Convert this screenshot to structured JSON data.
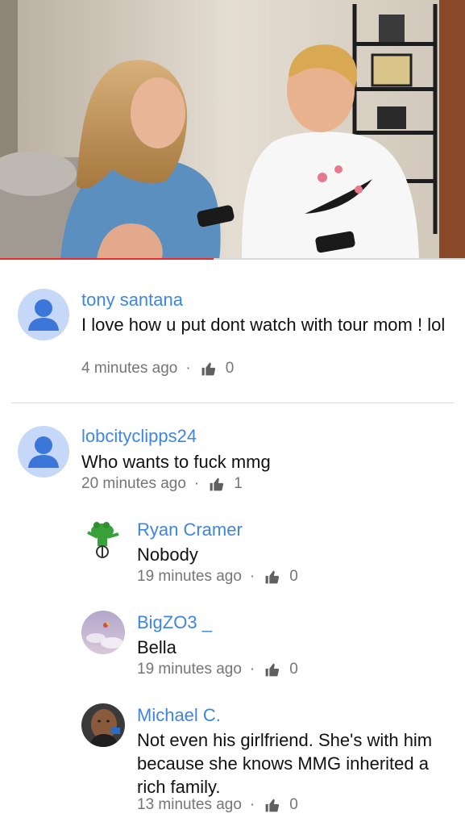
{
  "video": {
    "progress_fraction": 0.46
  },
  "comments": [
    {
      "author": "tony santana",
      "text": "I love how u put dont watch with tour mom ! lol",
      "time": "4 minutes ago",
      "likes": "0",
      "avatar": "default-user-icon"
    },
    {
      "author": "lobcityclipps24",
      "text": "Who wants to fuck mmg",
      "time": "20 minutes ago",
      "likes": "1",
      "avatar": "default-user-icon",
      "replies": [
        {
          "author": "Ryan Cramer",
          "text": "Nobody",
          "time": "19 minutes ago",
          "likes": "0",
          "avatar": "frog-avatar"
        },
        {
          "author": "BigZO3 _",
          "text": "Bella",
          "time": "19 minutes ago",
          "likes": "0",
          "avatar": "sky-avatar"
        },
        {
          "author": "Michael C.",
          "text": "Not even his girlfriend. She's with him because she knows MMG inherited a rich family.",
          "time": "13 minutes ago",
          "likes": "0",
          "avatar": "man-avatar"
        }
      ]
    }
  ],
  "colors": {
    "author": "#3d86e3",
    "progress": "#e52d27",
    "meta": "#757575"
  }
}
